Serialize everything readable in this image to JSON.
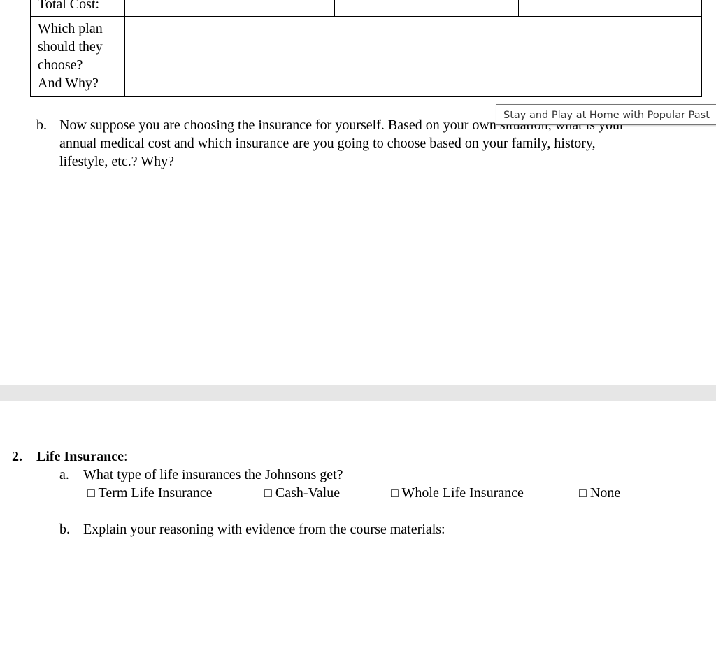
{
  "table": {
    "prev_row_label": "Total Cost:",
    "choose_row_label_lines": [
      "Which plan",
      "should they",
      "choose?",
      "And Why?"
    ]
  },
  "question_b1": {
    "marker": "b.",
    "lines": [
      "Now suppose you are choosing the insurance for yourself. Based on your own situation, what is your",
      "annual medical cost and which insurance are you going to choose based on your family, history,",
      "lifestyle, etc.?  Why?"
    ]
  },
  "tooltip": {
    "text": "Stay and Play at Home with Popular Past"
  },
  "section2": {
    "number": "2.",
    "title": "Life Insurance",
    "colon": ":",
    "qa": {
      "marker": "a.",
      "text": "What type of life insurances the Johnsons get?"
    },
    "options": [
      "Term Life Insurance",
      "Cash-Value",
      "Whole Life Insurance",
      "None"
    ],
    "checkbox_glyph": "□",
    "qb": {
      "marker": "b.",
      "text": "Explain your reasoning with evidence from the course materials:"
    }
  }
}
